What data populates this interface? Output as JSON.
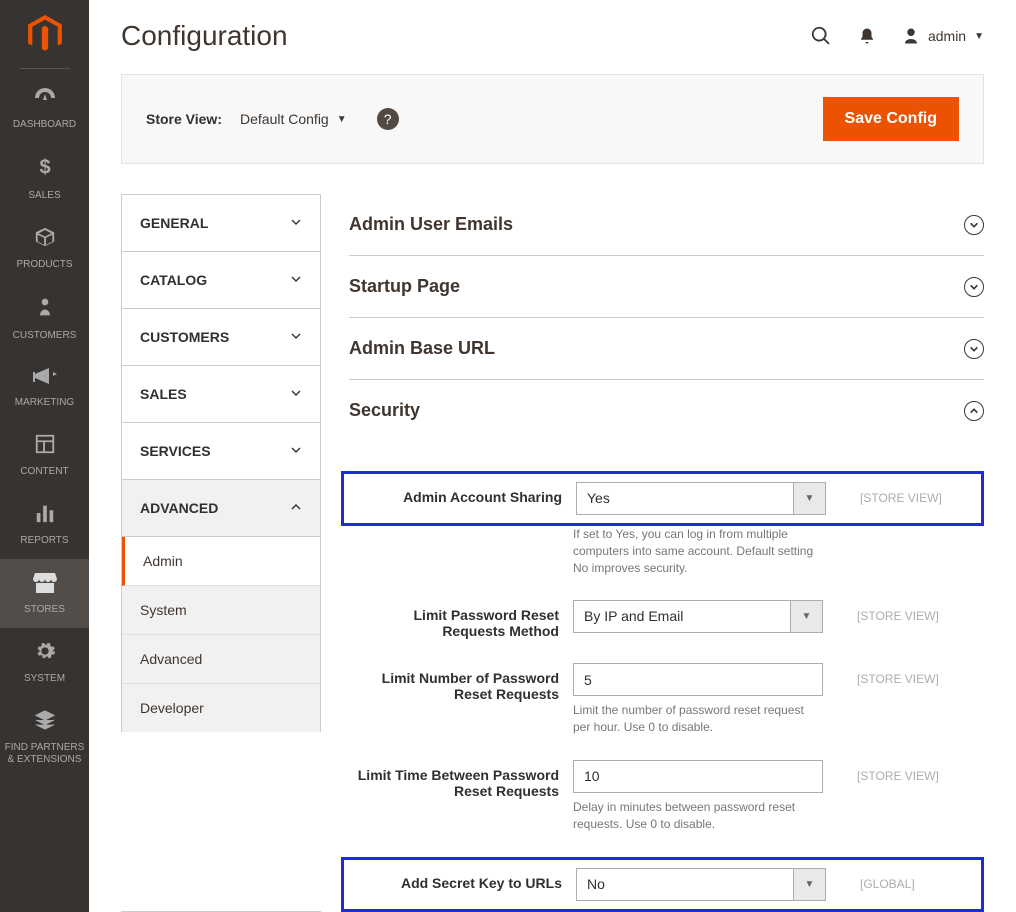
{
  "sidebar": {
    "items": [
      {
        "label": "DASHBOARD"
      },
      {
        "label": "SALES"
      },
      {
        "label": "PRODUCTS"
      },
      {
        "label": "CUSTOMERS"
      },
      {
        "label": "MARKETING"
      },
      {
        "label": "CONTENT"
      },
      {
        "label": "REPORTS"
      },
      {
        "label": "STORES"
      },
      {
        "label": "SYSTEM"
      },
      {
        "label": "FIND PARTNERS & EXTENSIONS"
      }
    ]
  },
  "header": {
    "title": "Configuration",
    "user": "admin"
  },
  "actionbar": {
    "store_view_label": "Store View:",
    "store_view_value": "Default Config",
    "save_label": "Save Config"
  },
  "tabs": {
    "groups": [
      {
        "label": "GENERAL",
        "open": false
      },
      {
        "label": "CATALOG",
        "open": false
      },
      {
        "label": "CUSTOMERS",
        "open": false
      },
      {
        "label": "SALES",
        "open": false
      },
      {
        "label": "SERVICES",
        "open": false
      },
      {
        "label": "ADVANCED",
        "open": true
      }
    ],
    "sub": [
      {
        "label": "Admin",
        "active": true
      },
      {
        "label": "System",
        "active": false
      },
      {
        "label": "Advanced",
        "active": false
      },
      {
        "label": "Developer",
        "active": false
      }
    ]
  },
  "sections": [
    {
      "title": "Admin User Emails"
    },
    {
      "title": "Startup Page"
    },
    {
      "title": "Admin Base URL"
    },
    {
      "title": "Security"
    }
  ],
  "fields": {
    "account_sharing": {
      "label": "Admin Account Sharing",
      "value": "Yes",
      "scope": "[STORE VIEW]",
      "note": "If set to Yes, you can log in from multiple computers into same account. Default setting No improves security."
    },
    "limit_method": {
      "label": "Limit Password Reset Requests Method",
      "value": "By IP and Email",
      "scope": "[STORE VIEW]"
    },
    "limit_number": {
      "label": "Limit Number of Password Reset Requests",
      "value": "5",
      "scope": "[STORE VIEW]",
      "note": "Limit the number of password reset request per hour. Use 0 to disable."
    },
    "limit_time": {
      "label": "Limit Time Between Password Reset Requests",
      "value": "10",
      "scope": "[STORE VIEW]",
      "note": "Delay in minutes between password reset requests. Use 0 to disable."
    },
    "secret_key": {
      "label": "Add Secret Key to URLs",
      "value": "No",
      "scope": "[GLOBAL]"
    }
  }
}
